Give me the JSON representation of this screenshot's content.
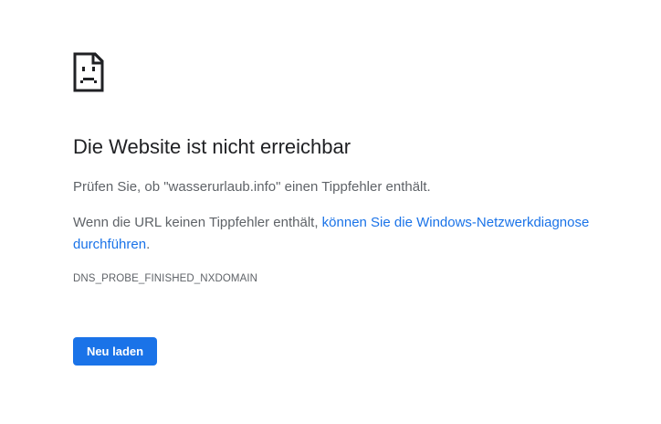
{
  "error": {
    "icon": "sad-page-icon",
    "title": "Die Website ist nicht erreichbar",
    "check_text": "Prüfen Sie, ob \"wasserurlaub.info\" einen Tippfehler enthält.",
    "diagnose_prefix": "Wenn die URL keinen Tippfehler enthält, ",
    "diagnose_link": "können Sie die Windows-Netzwerkdiagnose durchführen",
    "diagnose_suffix": ".",
    "code": "DNS_PROBE_FINISHED_NXDOMAIN"
  },
  "actions": {
    "reload_label": "Neu laden"
  },
  "colors": {
    "accent": "#1a73e8",
    "text_primary": "#202124",
    "text_secondary": "#5f6368"
  }
}
